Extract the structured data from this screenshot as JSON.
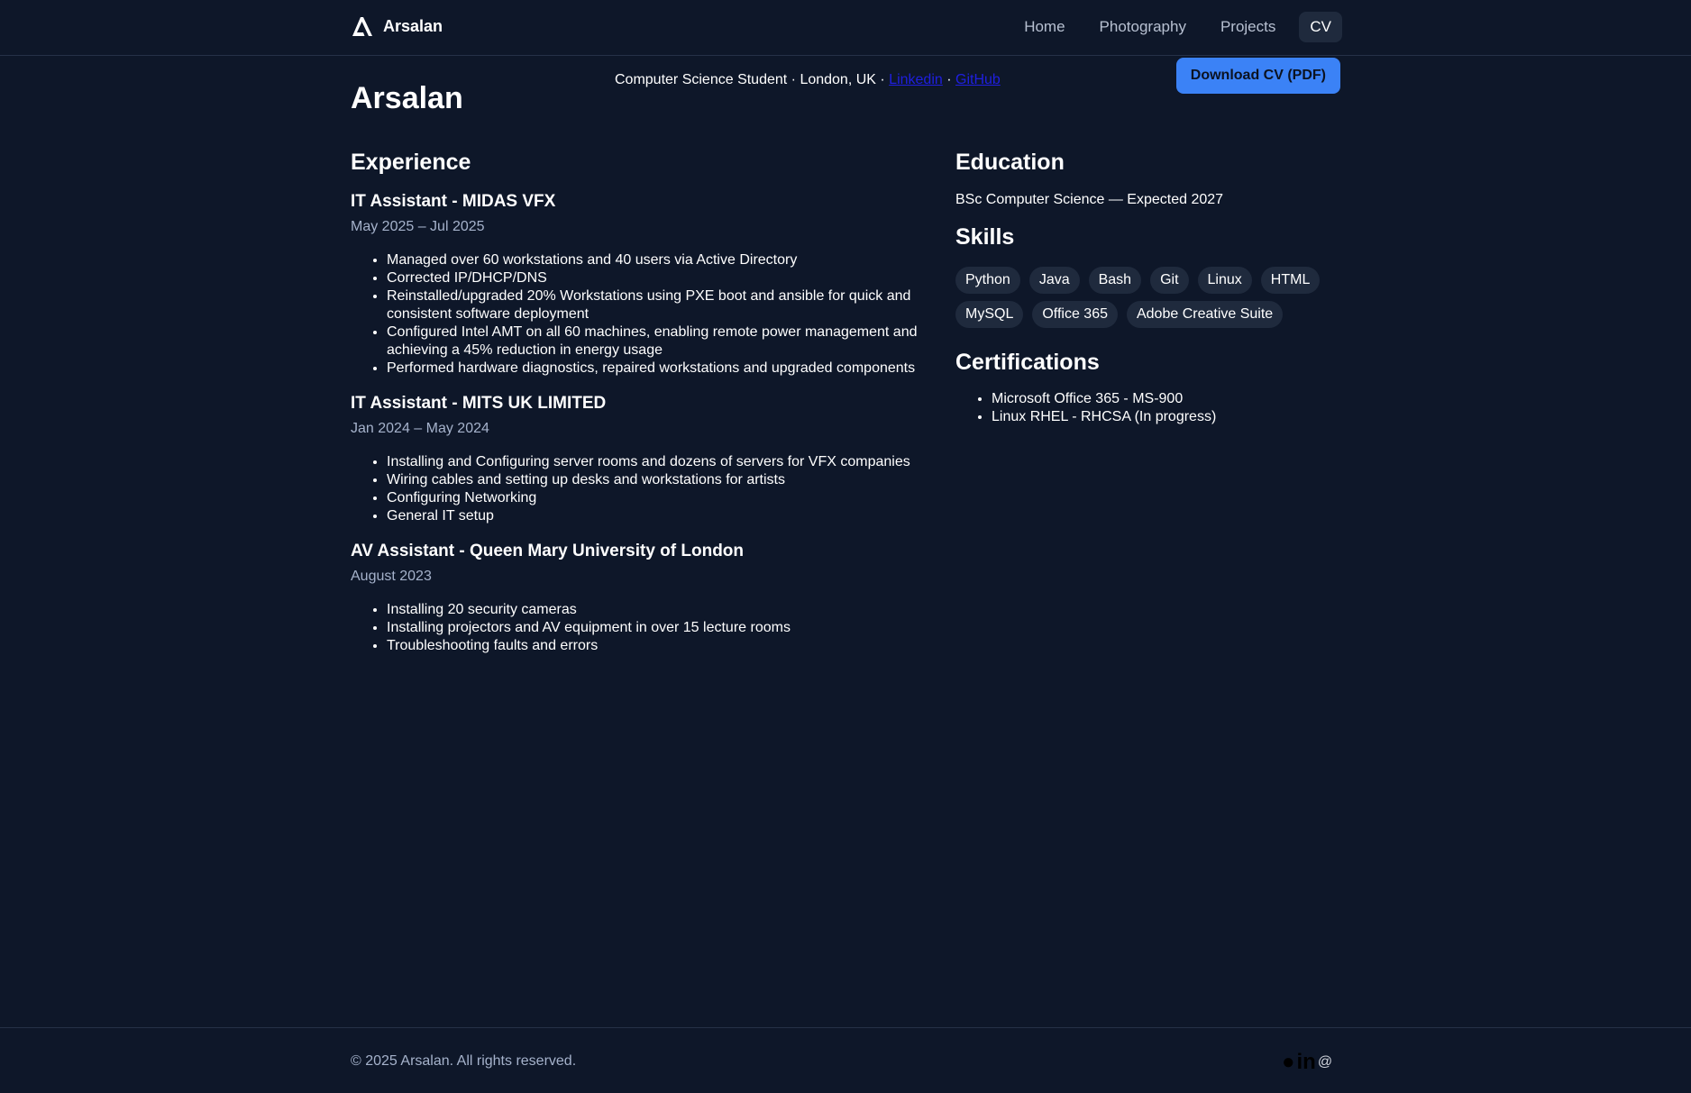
{
  "nav": {
    "brand": "Arsalan",
    "links": [
      "Home",
      "Photography",
      "Projects"
    ],
    "active": "CV"
  },
  "header": {
    "name": "Arsalan",
    "contact_text": "Computer Science Student · London, UK · ",
    "linkedin": "Linkedin",
    "separator": " · ",
    "github": "GitHub",
    "download_button": "Download CV (PDF)"
  },
  "experience": {
    "heading": "Experience",
    "jobs": [
      {
        "title": "IT Assistant - MIDAS VFX",
        "date": "May 2025 – Jul 2025",
        "bullets": [
          "Managed over 60 workstations and 40 users via Active Directory",
          "Corrected IP/DHCP/DNS",
          "Reinstalled/upgraded 20% Workstations using PXE boot and ansible for quick and consistent software deployment",
          "Configured Intel AMT on all 60 machines, enabling remote power management and achieving a 45% reduction in energy usage",
          "Performed hardware diagnostics, repaired workstations and upgraded components"
        ]
      },
      {
        "title": "IT Assistant - MITS UK LIMITED",
        "date": "Jan 2024 – May 2024",
        "bullets": [
          "Installing and Configuring server rooms and dozens of servers for VFX companies",
          "Wiring cables and setting up desks and workstations for artists",
          "Configuring Networking",
          "General IT setup"
        ]
      },
      {
        "title": "AV Assistant - Queen Mary University of London",
        "date": "August 2023",
        "bullets": [
          "Installing 20 security cameras",
          "Installing projectors and AV equipment in over 15 lecture rooms",
          "Troubleshooting faults and errors"
        ]
      }
    ]
  },
  "education": {
    "heading": "Education",
    "text": "BSc Computer Science — Expected 2027"
  },
  "skills": {
    "heading": "Skills",
    "items": [
      "Python",
      "Java",
      "Bash",
      "Git",
      "Linux",
      "HTML",
      "MySQL",
      "Office 365",
      "Adobe Creative Suite"
    ]
  },
  "certifications": {
    "heading": "Certifications",
    "items": [
      "Microsoft Office 365 - MS-900",
      "Linux RHEL - RHCSA (In progress)"
    ]
  },
  "footer": {
    "copyright": "© 2025 Arsalan. All rights reserved.",
    "social_icons": [
      "github-icon",
      "linkedin-icon",
      "email-icon"
    ]
  },
  "colors": {
    "background": "#0e1729",
    "accent": "#3b82f6",
    "chip_bg": "#1f2a3d",
    "muted_text": "#a5b2cb"
  }
}
